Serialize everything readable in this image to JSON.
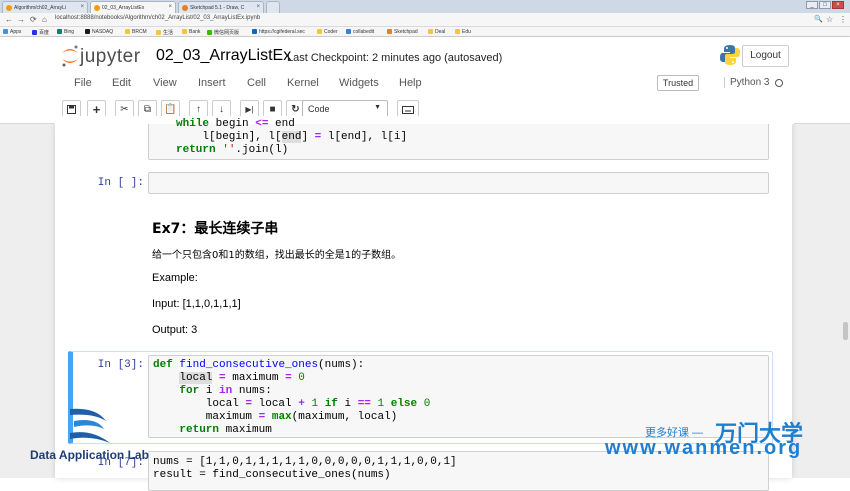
{
  "browser": {
    "tabs": [
      {
        "label": "Algorithm/ch02_ArrayLi",
        "color": "#f39c12"
      },
      {
        "label": "02_03_ArrayListEx",
        "color": "#f39c12"
      },
      {
        "label": "Sketchpad 5.1 - Draw, C",
        "color": "#e67e22"
      }
    ],
    "url": "localhost:8888/notebooks/Algorithm/ch02_ArrayList/02_03_ArrayListEx.ipynb",
    "bookmarks": [
      {
        "label": "Apps",
        "color": "#4a90d9"
      },
      {
        "label": "百度",
        "color": "#2932e1"
      },
      {
        "label": "Bing",
        "color": "#008373"
      },
      {
        "label": "NASDAQ",
        "color": "#1a1a1a"
      },
      {
        "label": "BRCM",
        "color": "#f5c542"
      },
      {
        "label": "生活",
        "color": "#f5c542"
      },
      {
        "label": "Bank",
        "color": "#f5c542"
      },
      {
        "label": "微信网页版",
        "color": "#2dc100"
      },
      {
        "label": "https://cgifederal.sec",
        "color": "#1565c0"
      },
      {
        "label": "Coder",
        "color": "#f5c542"
      },
      {
        "label": "collabedit",
        "color": "#3b7dd8"
      },
      {
        "label": "Sketchpad",
        "color": "#e67e22"
      },
      {
        "label": "Deal",
        "color": "#f5c542"
      },
      {
        "label": "Edu",
        "color": "#f5c542"
      }
    ]
  },
  "header": {
    "logo_text": "jupyter",
    "notebook_name": "02_03_ArrayListEx",
    "checkpoint": "Last Checkpoint: 2 minutes ago (autosaved)",
    "logout_label": "Logout"
  },
  "menubar": {
    "items": [
      "File",
      "Edit",
      "View",
      "Insert",
      "Cell",
      "Kernel",
      "Widgets",
      "Help"
    ],
    "trusted_label": "Trusted",
    "kernel_name": "Python 3"
  },
  "toolbar": {
    "cell_type": "Code"
  },
  "cells": {
    "prev_code_line1": "while begin <= end",
    "prev_code_line2": "l[begin], l[end] = l[end], l[i]",
    "prev_code_line3": "return ''.join(l)",
    "empty_prompt": "In [ ]:",
    "md_title": "Ex7：最长连续子串",
    "md_desc": "给一个只包含0和1的数组，找出最长的全是1的子数组。",
    "md_example": "Example:",
    "md_input": "Input: [1,1,0,1,1,1]",
    "md_output": "Output: 3",
    "code3_prompt": "In [3]:",
    "code7_prompt": "In [7]:",
    "code7_line1": "nums = [1,1,0,1,1,1,1,1,0,0,0,0,0,1,1,1,0,0,1]",
    "code7_line2": "result = find_consecutive_ones(nums)"
  },
  "watermark": {
    "lab_name": "Data Application Lab",
    "slogan": "更多好课 —",
    "brand": "万门大学",
    "url": "www.wanmen.org"
  }
}
